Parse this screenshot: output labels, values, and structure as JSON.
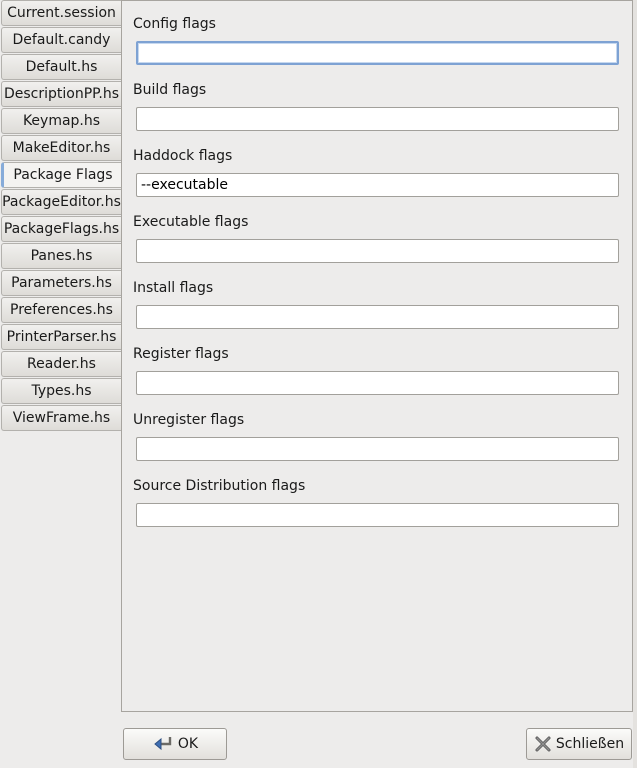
{
  "tabs": [
    {
      "label": "Current.session"
    },
    {
      "label": "Default.candy"
    },
    {
      "label": "Default.hs"
    },
    {
      "label": "DescriptionPP.hs"
    },
    {
      "label": "Keymap.hs"
    },
    {
      "label": "MakeEditor.hs"
    },
    {
      "label": "Package Flags",
      "active": true
    },
    {
      "label": "PackageEditor.hs"
    },
    {
      "label": "PackageFlags.hs"
    },
    {
      "label": "Panes.hs"
    },
    {
      "label": "Parameters.hs"
    },
    {
      "label": "Preferences.hs"
    },
    {
      "label": "PrinterParser.hs"
    },
    {
      "label": "Reader.hs"
    },
    {
      "label": "Types.hs"
    },
    {
      "label": "ViewFrame.hs"
    }
  ],
  "fields": {
    "config": {
      "label": "Config flags",
      "value": ""
    },
    "build": {
      "label": "Build flags",
      "value": ""
    },
    "haddock": {
      "label": "Haddock flags",
      "value": "--executable"
    },
    "executable": {
      "label": "Executable flags",
      "value": ""
    },
    "install": {
      "label": "Install flags",
      "value": ""
    },
    "register": {
      "label": "Register flags",
      "value": ""
    },
    "unregister": {
      "label": "Unregister flags",
      "value": ""
    },
    "sdist": {
      "label": "Source Distribution flags",
      "value": ""
    }
  },
  "buttons": {
    "ok": {
      "label": "OK",
      "icon": "return-arrow-icon"
    },
    "close": {
      "label": "Schließen",
      "icon": "close-x-icon"
    }
  },
  "colors": {
    "accent": "#86abd9",
    "focus_border": "#7ea2d3"
  }
}
